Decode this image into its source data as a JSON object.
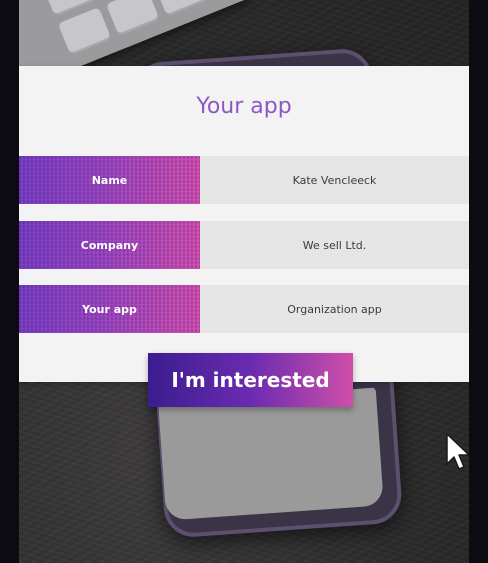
{
  "panel": {
    "title": "Your app"
  },
  "form_rows": [
    {
      "label": "Name",
      "value": "Kate Vencleeck"
    },
    {
      "label": "Company",
      "value": "We sell Ltd."
    },
    {
      "label": "Your app",
      "value": "Organization app"
    }
  ],
  "cta": {
    "label": "I'm interested"
  },
  "colors": {
    "title_purple": "#8c58c4",
    "gradient_start": "#7a3fc4",
    "gradient_end": "#d050ae",
    "button_start": "#3b1d8f",
    "button_end": "#cf4fa9",
    "panel_bg": "#f4f3f4",
    "value_bg": "#e6e5e6",
    "desk_bg": "#2b2a2a"
  },
  "icons": {
    "cursor": "mouse-pointer-icon"
  }
}
